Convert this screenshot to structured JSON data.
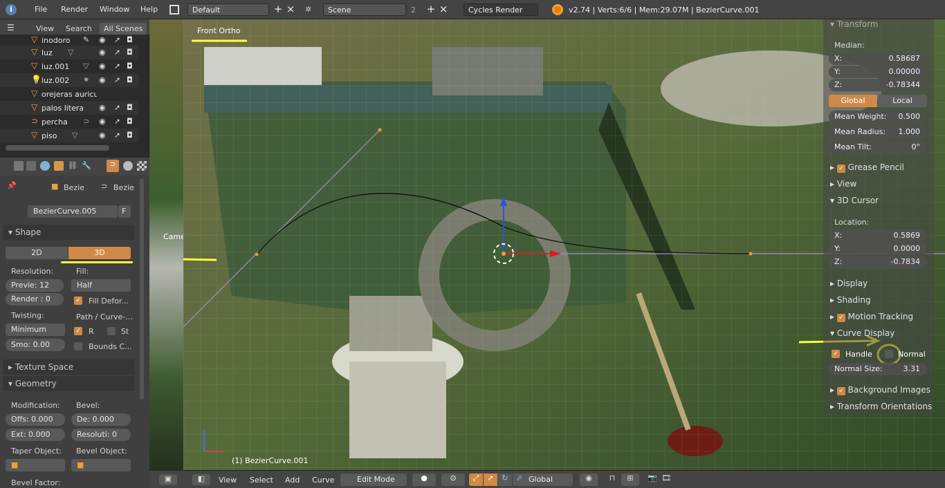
{
  "topbar": {
    "menus": [
      "File",
      "Render",
      "Window",
      "Help"
    ],
    "layout": "Default",
    "scene": "Scene",
    "scene_users": "2",
    "engine": "Cycles Render",
    "stats": "v2.74 | Verts:6/6 | Mem:29.07M | BezierCurve.001"
  },
  "outliner": {
    "tabs": [
      "View",
      "Search",
      "All Scenes"
    ],
    "items": [
      {
        "name": "inodoro"
      },
      {
        "name": "luz"
      },
      {
        "name": "luz.001"
      },
      {
        "name": "luz.002"
      },
      {
        "name": "orejeras auricul"
      },
      {
        "name": "palos litera"
      },
      {
        "name": "percha"
      },
      {
        "name": "piso"
      }
    ]
  },
  "properties": {
    "context": [
      "Bezie",
      "Bezie"
    ],
    "datablock": "BezierCurve.005",
    "fake_user": "F",
    "shape": {
      "title": "Shape",
      "dim_2d": "2D",
      "dim_3d": "3D",
      "resolution_label": "Resolution:",
      "fill_label": "Fill:",
      "preview": "Previe: 12",
      "render": "Render : 0",
      "fill_value": "Half",
      "fill_deform": "Fill Defor...",
      "twisting_label": "Twisting:",
      "path_curve": "Path / Curve-...",
      "twist_value": "Minimum",
      "r_label": "R",
      "st_label": "St",
      "smooth": "Smo: 0.00",
      "bounds": "Bounds C..."
    },
    "texture_space": "Texture Space",
    "geometry": {
      "title": "Geometry",
      "modification": "Modification:",
      "bevel": "Bevel:",
      "offset": "Offs: 0.000",
      "depth": "De:  0.000",
      "extrude": "Ext: 0.000",
      "resolution": "Resoluti:  0",
      "taper": "Taper Object:",
      "bevel_obj": "Bevel Object:",
      "bevel_factor": "Bevel Factor:"
    }
  },
  "viewport": {
    "view_name": "Front Ortho",
    "object_label": "(1) BezierCurve.001",
    "camera_label": "Came"
  },
  "npanel": {
    "transform": "Transform",
    "median": "Median:",
    "x": "0.58687",
    "y": "0.00000",
    "z": "-0.78344",
    "global": "Global",
    "local": "Local",
    "mean_weight": "0.500",
    "mean_radius": "1.000",
    "mean_tilt": "0°",
    "grease_pencil": "Grease Pencil",
    "view": "View",
    "cursor": "3D Cursor",
    "location": "Location:",
    "cx": "0.5869",
    "cy": "0.0000",
    "cz": "-0.7834",
    "display": "Display",
    "shading": "Shading",
    "motion_tracking": "Motion Tracking",
    "curve_display": "Curve Display",
    "handle": "Handle",
    "normal": "Normal",
    "normal_size": "3.31",
    "background_images": "Background Images",
    "transform_orientations": "Transform Orientations"
  },
  "bottombar": {
    "menus": [
      "View",
      "Select",
      "Add",
      "Curve"
    ],
    "mode": "Edit Mode",
    "orientation": "Global"
  },
  "colors": {
    "accent": "#cf8a47",
    "highlight": "#ffff3c"
  }
}
